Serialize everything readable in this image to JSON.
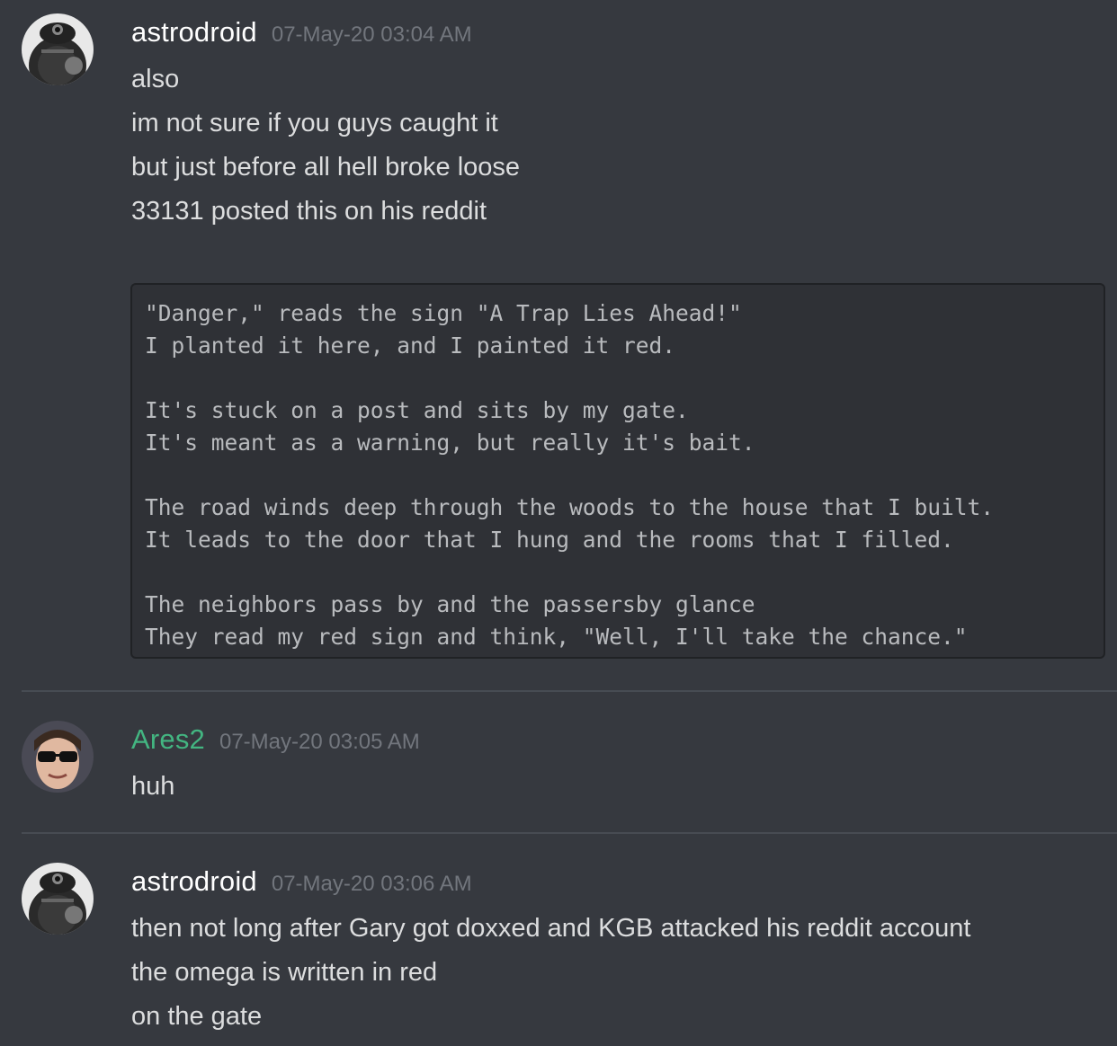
{
  "messages": [
    {
      "username": "astrodroid",
      "timestamp": "07-May-20 03:04 AM",
      "lines": [
        "also",
        "im not sure if you guys caught it",
        "but just before all hell broke loose",
        "33131 posted this on his reddit"
      ],
      "code_lines": [
        "\"Danger,\" reads the sign \"A Trap Lies Ahead!\"",
        "I planted it here, and I painted it red.",
        "",
        "It's stuck on a post and sits by my gate.",
        "It's meant as a warning, but really it's bait.",
        "",
        "The road winds deep through the woods to the house that I built.",
        "It leads to the door that I hung and the rooms that I filled.",
        "",
        "The neighbors pass by and the passersby glance",
        "They read my red sign and think, \"Well, I'll take the chance.\""
      ]
    },
    {
      "username": "Ares2",
      "username_color": "#43b581",
      "timestamp": "07-May-20 03:05 AM",
      "lines": [
        "huh"
      ]
    },
    {
      "username": "astrodroid",
      "timestamp": "07-May-20 03:06 AM",
      "lines": [
        "then not long after Gary got doxxed and KGB attacked his reddit account",
        "the omega is written in red",
        "on the gate"
      ]
    }
  ]
}
